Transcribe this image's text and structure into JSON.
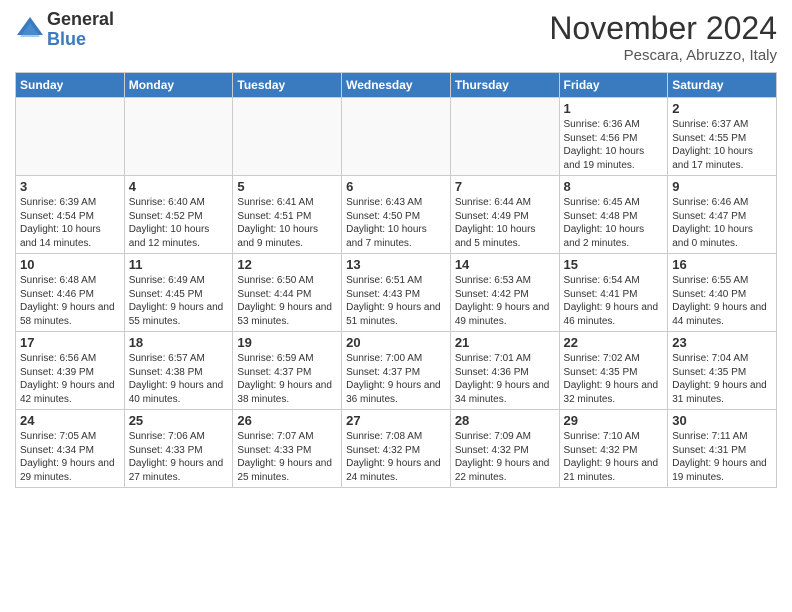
{
  "header": {
    "logo_general": "General",
    "logo_blue": "Blue",
    "month_title": "November 2024",
    "location": "Pescara, Abruzzo, Italy"
  },
  "days_of_week": [
    "Sunday",
    "Monday",
    "Tuesday",
    "Wednesday",
    "Thursday",
    "Friday",
    "Saturday"
  ],
  "weeks": [
    [
      {
        "day": "",
        "info": ""
      },
      {
        "day": "",
        "info": ""
      },
      {
        "day": "",
        "info": ""
      },
      {
        "day": "",
        "info": ""
      },
      {
        "day": "",
        "info": ""
      },
      {
        "day": "1",
        "info": "Sunrise: 6:36 AM\nSunset: 4:56 PM\nDaylight: 10 hours and 19 minutes."
      },
      {
        "day": "2",
        "info": "Sunrise: 6:37 AM\nSunset: 4:55 PM\nDaylight: 10 hours and 17 minutes."
      }
    ],
    [
      {
        "day": "3",
        "info": "Sunrise: 6:39 AM\nSunset: 4:54 PM\nDaylight: 10 hours and 14 minutes."
      },
      {
        "day": "4",
        "info": "Sunrise: 6:40 AM\nSunset: 4:52 PM\nDaylight: 10 hours and 12 minutes."
      },
      {
        "day": "5",
        "info": "Sunrise: 6:41 AM\nSunset: 4:51 PM\nDaylight: 10 hours and 9 minutes."
      },
      {
        "day": "6",
        "info": "Sunrise: 6:43 AM\nSunset: 4:50 PM\nDaylight: 10 hours and 7 minutes."
      },
      {
        "day": "7",
        "info": "Sunrise: 6:44 AM\nSunset: 4:49 PM\nDaylight: 10 hours and 5 minutes."
      },
      {
        "day": "8",
        "info": "Sunrise: 6:45 AM\nSunset: 4:48 PM\nDaylight: 10 hours and 2 minutes."
      },
      {
        "day": "9",
        "info": "Sunrise: 6:46 AM\nSunset: 4:47 PM\nDaylight: 10 hours and 0 minutes."
      }
    ],
    [
      {
        "day": "10",
        "info": "Sunrise: 6:48 AM\nSunset: 4:46 PM\nDaylight: 9 hours and 58 minutes."
      },
      {
        "day": "11",
        "info": "Sunrise: 6:49 AM\nSunset: 4:45 PM\nDaylight: 9 hours and 55 minutes."
      },
      {
        "day": "12",
        "info": "Sunrise: 6:50 AM\nSunset: 4:44 PM\nDaylight: 9 hours and 53 minutes."
      },
      {
        "day": "13",
        "info": "Sunrise: 6:51 AM\nSunset: 4:43 PM\nDaylight: 9 hours and 51 minutes."
      },
      {
        "day": "14",
        "info": "Sunrise: 6:53 AM\nSunset: 4:42 PM\nDaylight: 9 hours and 49 minutes."
      },
      {
        "day": "15",
        "info": "Sunrise: 6:54 AM\nSunset: 4:41 PM\nDaylight: 9 hours and 46 minutes."
      },
      {
        "day": "16",
        "info": "Sunrise: 6:55 AM\nSunset: 4:40 PM\nDaylight: 9 hours and 44 minutes."
      }
    ],
    [
      {
        "day": "17",
        "info": "Sunrise: 6:56 AM\nSunset: 4:39 PM\nDaylight: 9 hours and 42 minutes."
      },
      {
        "day": "18",
        "info": "Sunrise: 6:57 AM\nSunset: 4:38 PM\nDaylight: 9 hours and 40 minutes."
      },
      {
        "day": "19",
        "info": "Sunrise: 6:59 AM\nSunset: 4:37 PM\nDaylight: 9 hours and 38 minutes."
      },
      {
        "day": "20",
        "info": "Sunrise: 7:00 AM\nSunset: 4:37 PM\nDaylight: 9 hours and 36 minutes."
      },
      {
        "day": "21",
        "info": "Sunrise: 7:01 AM\nSunset: 4:36 PM\nDaylight: 9 hours and 34 minutes."
      },
      {
        "day": "22",
        "info": "Sunrise: 7:02 AM\nSunset: 4:35 PM\nDaylight: 9 hours and 32 minutes."
      },
      {
        "day": "23",
        "info": "Sunrise: 7:04 AM\nSunset: 4:35 PM\nDaylight: 9 hours and 31 minutes."
      }
    ],
    [
      {
        "day": "24",
        "info": "Sunrise: 7:05 AM\nSunset: 4:34 PM\nDaylight: 9 hours and 29 minutes."
      },
      {
        "day": "25",
        "info": "Sunrise: 7:06 AM\nSunset: 4:33 PM\nDaylight: 9 hours and 27 minutes."
      },
      {
        "day": "26",
        "info": "Sunrise: 7:07 AM\nSunset: 4:33 PM\nDaylight: 9 hours and 25 minutes."
      },
      {
        "day": "27",
        "info": "Sunrise: 7:08 AM\nSunset: 4:32 PM\nDaylight: 9 hours and 24 minutes."
      },
      {
        "day": "28",
        "info": "Sunrise: 7:09 AM\nSunset: 4:32 PM\nDaylight: 9 hours and 22 minutes."
      },
      {
        "day": "29",
        "info": "Sunrise: 7:10 AM\nSunset: 4:32 PM\nDaylight: 9 hours and 21 minutes."
      },
      {
        "day": "30",
        "info": "Sunrise: 7:11 AM\nSunset: 4:31 PM\nDaylight: 9 hours and 19 minutes."
      }
    ]
  ]
}
